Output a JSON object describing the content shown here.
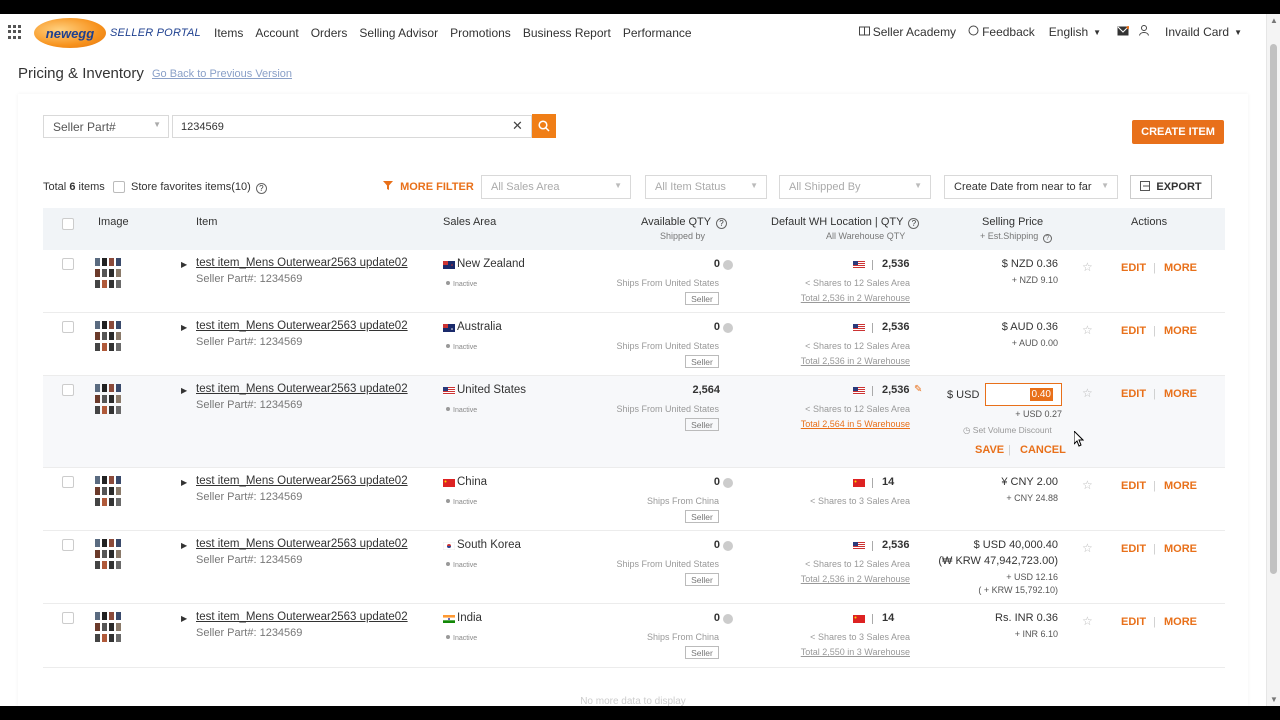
{
  "header": {
    "logo_text": "newegg",
    "portal_label": "SELLER PORTAL",
    "nav": [
      "Items",
      "Account",
      "Orders",
      "Selling Advisor",
      "Promotions",
      "Business Report",
      "Performance"
    ],
    "seller_academy": "Seller Academy",
    "feedback": "Feedback",
    "language": "English",
    "account": "Invaild Card"
  },
  "page": {
    "title": "Pricing & Inventory",
    "back_link": "Go Back to Previous Version"
  },
  "search": {
    "field": "Seller Part#",
    "value": "1234569"
  },
  "create_button": "CREATE ITEM",
  "filters": {
    "total_label": "Total",
    "total_count": "6",
    "total_suffix": "items",
    "favorites": "Store favorites items(10)",
    "more_filter": "MORE FILTER",
    "sales_area_placeholder": "All Sales Area",
    "item_status_placeholder": "All Item Status",
    "shipped_by_placeholder": "All Shipped By",
    "sort": "Create Date from near to far",
    "export": "EXPORT"
  },
  "table": {
    "headers": {
      "image": "Image",
      "item": "Item",
      "sales_area": "Sales Area",
      "available_qty": "Available QTY",
      "available_qty_sub": "Shipped by",
      "wh": "Default WH Location | QTY",
      "wh_sub": "All Warehouse QTY",
      "price": "Selling Price",
      "price_sub": "+ Est.Shipping",
      "actions": "Actions"
    },
    "rows": [
      {
        "title": "test item_Mens Outerwear2563 update02",
        "part": "Seller Part#: 1234569",
        "area": "New Zealand",
        "status": "Inactive",
        "qty": "0",
        "ships": "Ships From  United States",
        "seller": "Seller",
        "wh_qty": "2,536",
        "shares": "Shares to 12 Sales Area",
        "wh_total": "Total 2,536 in 2 Warehouse",
        "price": "$ NZD 0.36",
        "price_sub": "+ NZD 9.10",
        "edit": "EDIT",
        "more": "MORE"
      },
      {
        "title": "test item_Mens Outerwear2563 update02",
        "part": "Seller Part#: 1234569",
        "area": "Australia",
        "status": "Inactive",
        "qty": "0",
        "ships": "Ships From  United States",
        "seller": "Seller",
        "wh_qty": "2,536",
        "shares": "Shares to 12 Sales Area",
        "wh_total": "Total 2,536 in 2 Warehouse",
        "price": "$ AUD 0.36",
        "price_sub": "+ AUD 0.00",
        "edit": "EDIT",
        "more": "MORE"
      },
      {
        "title": "test item_Mens Outerwear2563 update02",
        "part": "Seller Part#: 1234569",
        "area": "United States",
        "status": "Inactive",
        "qty": "2,564",
        "ships": "Ships From  United States",
        "seller": "Seller",
        "wh_qty": "2,536",
        "shares": "Shares to 12 Sales Area",
        "wh_total": "Total 2,564 in 5 Warehouse",
        "usd_label": "$ USD",
        "price_input": "0.40",
        "price_sub": "+ USD 0.27",
        "volume_discount": "Set Volume Discount",
        "save": "SAVE",
        "cancel": "CANCEL",
        "edit": "EDIT",
        "more": "MORE"
      },
      {
        "title": "test item_Mens Outerwear2563 update02",
        "part": "Seller Part#: 1234569",
        "area": "China",
        "status": "Inactive",
        "qty": "0",
        "ships": "Ships From  China",
        "seller": "Seller",
        "wh_qty": "14",
        "shares": "Shares to 3 Sales Area",
        "price": "¥ CNY 2.00",
        "price_sub": "+ CNY 24.88",
        "edit": "EDIT",
        "more": "MORE"
      },
      {
        "title": "test item_Mens Outerwear2563 update02",
        "part": "Seller Part#: 1234569",
        "area": "South Korea",
        "status": "Inactive",
        "qty": "0",
        "ships": "Ships From  United States",
        "seller": "Seller",
        "wh_qty": "2,536",
        "shares": "Shares to 12 Sales Area",
        "wh_total": "Total 2,536 in 2 Warehouse",
        "price": "$ USD 40,000.40",
        "price_krw": "(₩ KRW 47,942,723.00)",
        "price_sub": "+ USD 12.16",
        "price_sub_krw": "( + KRW 15,792.10)",
        "edit": "EDIT",
        "more": "MORE"
      },
      {
        "title": "test item_Mens Outerwear2563 update02",
        "part": "Seller Part#: 1234569",
        "area": "India",
        "status": "Inactive",
        "qty": "0",
        "ships": "Ships From  China",
        "seller": "Seller",
        "wh_qty": "14",
        "shares": "Shares to 3 Sales Area",
        "wh_total": "Total 2,550 in 3 Warehouse",
        "price": "Rs. INR 0.36",
        "price_sub": "+ INR 6.10",
        "edit": "EDIT",
        "more": "MORE"
      }
    ],
    "footer": "No more data to display"
  },
  "colors": {
    "accent": "#e8701a",
    "header_row": "#f1f4f7"
  }
}
